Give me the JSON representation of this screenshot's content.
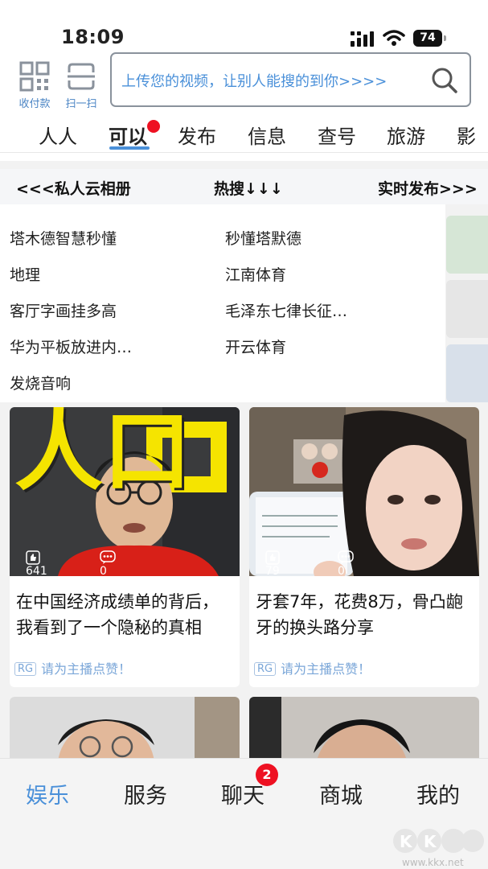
{
  "status_bar": {
    "time": "18:09",
    "battery": "74"
  },
  "quick_actions": [
    {
      "label": "收付款",
      "icon": "qr-code-icon"
    },
    {
      "label": "扫一扫",
      "icon": "scan-icon"
    }
  ],
  "search": {
    "placeholder": "上传您的视频，让别人能搜的到你>>>>",
    "icon": "search-icon"
  },
  "tabs": [
    "人人",
    "可以",
    "发布",
    "信息",
    "查号",
    "旅游",
    "影"
  ],
  "active_tab": "可以",
  "hot_header": {
    "left": "<<<私人云相册",
    "center": "热搜↓↓↓",
    "right": "实时发布>>>"
  },
  "hot_searches": {
    "left": [
      "塔木德智慧秒懂",
      "地理",
      "客厅字画挂多高",
      "华为平板放进内…",
      "发烧音响"
    ],
    "right": [
      "秒懂塔默德",
      "江南体育",
      "毛泽东七律长征…",
      "开云体育"
    ]
  },
  "cards": [
    {
      "likes": "641",
      "comments": "0",
      "image_text": "人口",
      "title": "在中国经济成绩单的背后，我看到了一个隐秘的真相",
      "badge": "RG",
      "tag": "请为主播点赞！"
    },
    {
      "likes": "79",
      "comments": "0",
      "title": "牙套7年，花费8万，骨凸龅牙的换头路分享",
      "badge": "RG",
      "tag": "请为主播点赞！"
    }
  ],
  "bottom_nav": [
    "娱乐",
    "服务",
    "聊天",
    "商城",
    "我的"
  ],
  "active_nav": "娱乐",
  "chat_badge": "2",
  "watermark": {
    "brand": "KK下载",
    "url": "www.kkx.net"
  },
  "colors": {
    "accent": "#4a90d9",
    "badge": "#ee1122",
    "tag": "#7aa6d8"
  }
}
